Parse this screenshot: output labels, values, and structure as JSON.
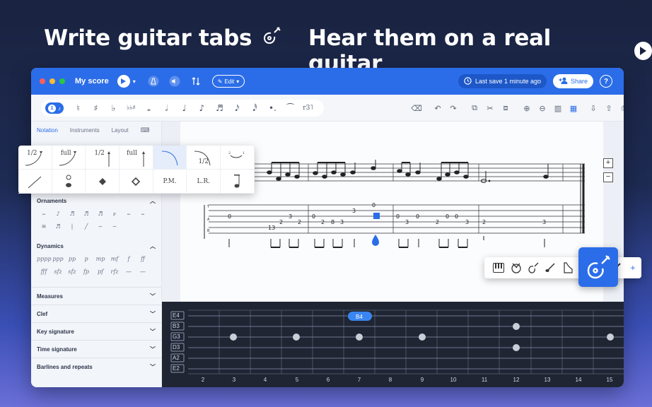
{
  "headlines": {
    "left": "Write guitar tabs",
    "right": "Hear them on a real guitar",
    "left_icon": "guitar-icon",
    "right_icon": "play-icon"
  },
  "titlebar": {
    "title": "My score",
    "edit_label": "Edit",
    "last_save": "Last save 1 minute ago",
    "share_label": "Share",
    "help_label": "?"
  },
  "toolbar": {
    "voice_number": "1",
    "left_glyphs": [
      "♮",
      "♯",
      "♭",
      "♭♭♯",
      "𝅝",
      "𝅗𝅥",
      "♩",
      "♪",
      "♬",
      "𝅘𝅥𝅯",
      "𝅘𝅥𝅰",
      "•.",
      "⁀",
      "r3˥"
    ],
    "right_glyphs": [
      "⌫",
      "↶",
      "↷",
      "⧉",
      "✂",
      "⧈",
      "⊕",
      "⊖",
      "▥",
      "▦",
      "⇩",
      "⇧",
      "⎙"
    ]
  },
  "sidebar": {
    "tabs": [
      "Notation",
      "Instruments",
      "Layout"
    ],
    "sections": {
      "ornaments": "Ornaments",
      "dynamics": "Dynamics"
    },
    "ornament_glyphs": [
      "𝆗",
      "♪",
      "♬",
      "♬",
      "♬",
      "𝆖",
      "𝆗",
      "𝆘",
      "≋",
      "♬",
      "|",
      "╱",
      "∽",
      "∽",
      ""
    ],
    "dynamic_glyphs": [
      "pppp",
      "ppp",
      "pp",
      "p",
      "mp",
      "mf",
      "f",
      "ff",
      "fff",
      "sfz",
      "sfz",
      "fp",
      "pf",
      "rfz",
      "—",
      "—"
    ],
    "accordions": [
      "Measures",
      "Clef",
      "Key signature",
      "Time signature",
      "Barlines and repeats"
    ]
  },
  "bend_popover": {
    "cells": [
      {
        "label": "1/2",
        "sel": false
      },
      {
        "label": "full",
        "sel": false
      },
      {
        "label": "1/2",
        "sel": false
      },
      {
        "label": "full",
        "sel": false
      },
      {
        "label": "",
        "sel": true
      },
      {
        "label": "1/2",
        "sel": false
      },
      {
        "label": "",
        "sel": false
      },
      {
        "label": "",
        "sel": false
      },
      {
        "label": "",
        "sel": false
      },
      {
        "label": "",
        "sel": false
      },
      {
        "label": "",
        "sel": false
      },
      {
        "label": "P.M.",
        "sel": false
      },
      {
        "label": "L.R.",
        "sel": false
      },
      {
        "label": "",
        "sel": false
      }
    ]
  },
  "tab": {
    "strings_label": "TAB",
    "measure1": [
      "0",
      "3",
      "2",
      "0",
      "13",
      "2"
    ],
    "measure2": [
      "0",
      "2",
      "8",
      "3",
      "3"
    ],
    "measure3": [
      "0",
      "3",
      "2",
      "0"
    ],
    "measure4": [
      "0",
      "3",
      "0",
      "2",
      "0",
      "3"
    ],
    "measure5": [
      "2",
      "3"
    ]
  },
  "fretboard": {
    "strings": [
      "E4",
      "B3",
      "G3",
      "D3",
      "A2",
      "E2"
    ],
    "frets": [
      "2",
      "3",
      "4",
      "5",
      "6",
      "7",
      "8",
      "9",
      "10",
      "11",
      "12",
      "13",
      "14",
      "15"
    ],
    "active_note": "B4"
  },
  "instruments": [
    "piano-icon",
    "drums-icon",
    "guitar-icon",
    "violin-icon",
    "harp-icon",
    "guitar-selected-icon"
  ],
  "instrument_add": "+",
  "colors": {
    "accent": "#2b6de8",
    "background": "#1a2340",
    "fretboard": "#1f2533"
  }
}
